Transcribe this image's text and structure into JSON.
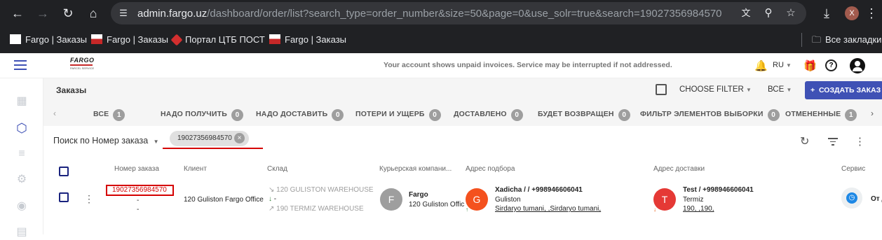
{
  "browser": {
    "url_host": "admin.fargo.uz",
    "url_path": "/dashboard/order/list?search_type=order_number&size=50&page=0&use_solr=true&search=19027356984570",
    "profile_initial": "X",
    "bookmarks": [
      {
        "label": "Fargo | Заказы"
      },
      {
        "label": "Fargo | Заказы"
      },
      {
        "label": "Портал ЦТБ ПОСТ"
      },
      {
        "label": "Fargo | Заказы"
      }
    ],
    "all_bookmarks_label": "Все закладки"
  },
  "header": {
    "logo_text": "FARGO",
    "logo_sub": "PARCEL SERVICE",
    "notice": "Your account shows unpaid invoices. Service may be interrupted if not addressed.",
    "language": "RU"
  },
  "toolbar": {
    "title": "Заказы",
    "choose_filter": "CHOOSE FILTER",
    "all_select": "ВСЕ",
    "create_order": "СОЗДАТЬ ЗАКАЗ"
  },
  "tabs": [
    {
      "label": "ВСЕ",
      "count": "1"
    },
    {
      "label": "НАДО ПОЛУЧИТЬ",
      "count": "0"
    },
    {
      "label": "НАДО ДОСТАВИТЬ",
      "count": "0"
    },
    {
      "label": "ПОТЕРИ И УЩЕРБ",
      "count": "0"
    },
    {
      "label": "ДОСТАВЛЕНО",
      "count": "0"
    },
    {
      "label": "БУДЕТ ВОЗВРАЩЕН",
      "count": "0"
    },
    {
      "label": "ФИЛЬТР ЭЛЕМЕНТОВ ВЫБОРКИ",
      "count": "0"
    },
    {
      "label": "ОТМЕНЕННЫЕ",
      "count": "1"
    }
  ],
  "search": {
    "type_label": "Поиск по Номер заказа",
    "chip_value": "19027356984570"
  },
  "table": {
    "headers": {
      "order_number": "Номер заказа",
      "client": "Клиент",
      "warehouse": "Склад",
      "courier": "Курьерская компани...",
      "pickup": "Адрес подбора",
      "delivery": "Адрес доставки",
      "service": "Сервис"
    },
    "row": {
      "order_number": "19027356984570",
      "dash1": "-",
      "dash2": "-",
      "client": "120 Guliston Fargo Office",
      "wh_from": "120 GULISTON WAREHOUSE",
      "wh_current": "-",
      "wh_to": "190 TERMIZ WAREHOUSE",
      "courier_initial": "F",
      "courier_name": "Fargo",
      "courier_office": "120 Guliston Offic",
      "pickup_initial": "G",
      "pickup_name": "Xadicha / / +998946606041",
      "pickup_city": "Guliston",
      "pickup_address": "Sirdaryo tumani, ,Sirdaryo tumani,",
      "delivery_initial": "T",
      "delivery_name": "Test / +998946606041",
      "delivery_city": "Termiz",
      "delivery_address": "190, ,190,",
      "service_text": "От Д"
    }
  },
  "colors": {
    "accent": "#3f51b5",
    "highlight_red": "#d50000",
    "pickup_avatar": "#f4511e",
    "delivery_avatar": "#e53935",
    "courier_avatar": "#9e9e9e"
  }
}
